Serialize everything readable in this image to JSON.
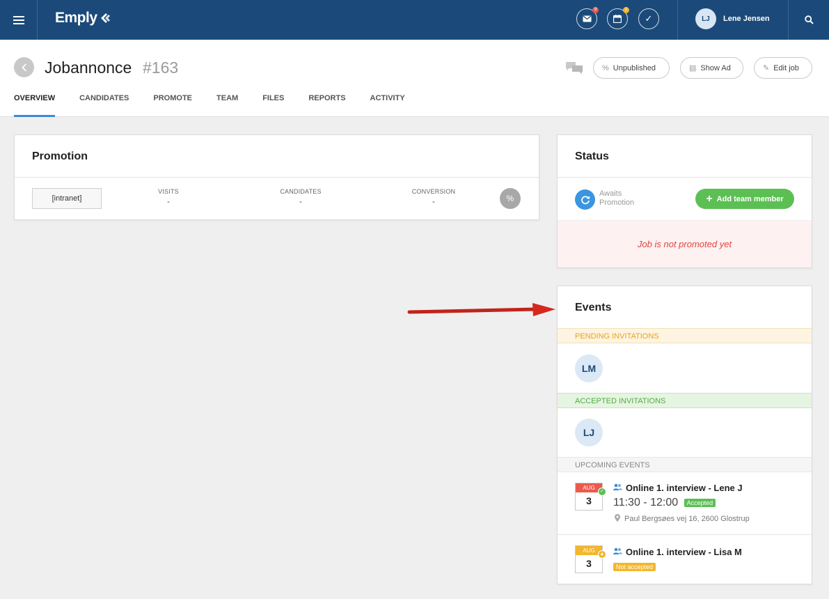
{
  "app": {
    "logo": "Emply"
  },
  "topbar": {
    "mail_badge": "9",
    "calendar_badge": "1",
    "user": {
      "initials": "LJ",
      "name": "Lene Jensen"
    }
  },
  "header": {
    "title": "Jobannonce",
    "number": "#163",
    "buttons": {
      "unpublished": "Unpublished",
      "show_ad": "Show Ad",
      "edit_job": "Edit job"
    }
  },
  "tabs": [
    "OVERVIEW",
    "CANDIDATES",
    "PROMOTE",
    "TEAM",
    "FILES",
    "REPORTS",
    "ACTIVITY"
  ],
  "promotion": {
    "title": "Promotion",
    "channel": "[intranet]",
    "metrics": [
      {
        "label": "VISITS",
        "value": "-"
      },
      {
        "label": "CANDIDATES",
        "value": "-"
      },
      {
        "label": "CONVERSION",
        "value": "-"
      }
    ]
  },
  "status": {
    "title": "Status",
    "state_line1": "Awaits",
    "state_line2": "Promotion",
    "add_team_member": "Add team member",
    "message": "Job is not promoted yet"
  },
  "events": {
    "title": "Events",
    "pending_label": "PENDING INVITATIONS",
    "pending": [
      "LM"
    ],
    "accepted_label": "ACCEPTED INVITATIONS",
    "accepted": [
      "LJ"
    ],
    "upcoming_label": "UPCOMING EVENTS",
    "items": [
      {
        "month": "AUG",
        "day": "3",
        "title": "Online 1. interview - Lene J",
        "time": "11:30 - 12:00",
        "status": "Accepted",
        "location": "Paul Bergsøes vej 16, 2600 Glostrup"
      },
      {
        "month": "AUG",
        "day": "3",
        "title": "Online 1. interview - Lisa M",
        "status": "Not accepted"
      }
    ]
  },
  "colors": {
    "topbar": "#1b4a7a",
    "accent": "#3a8ad6",
    "green": "#5cbf54",
    "pending": "#e9a21c",
    "alert": "#e0453d",
    "calendar_red": "#ec5a4e",
    "calendar_yellow": "#f3b62c"
  }
}
